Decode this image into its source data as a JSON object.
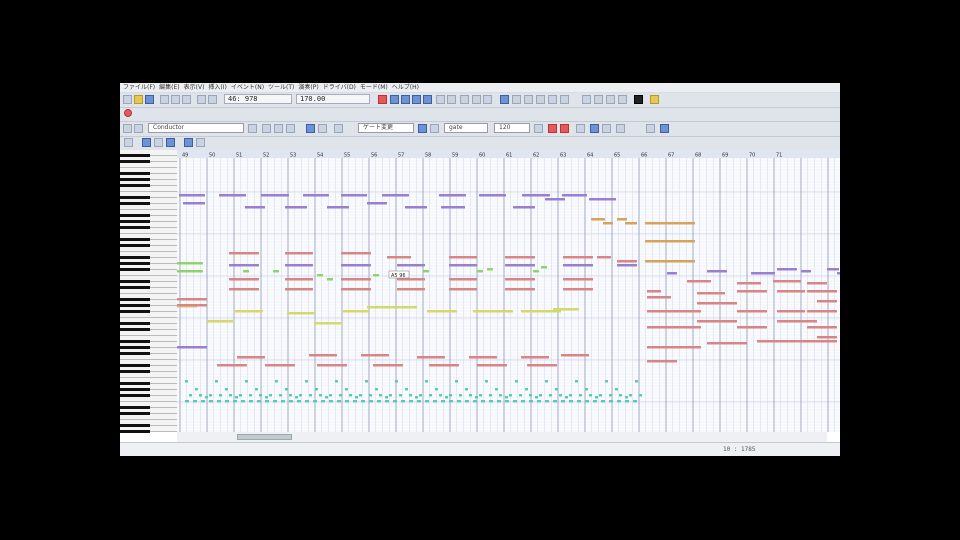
{
  "window": {
    "menu": [
      "ファイル(F)",
      "編集(E)",
      "表示(V)",
      "挿入(I)",
      "イベント(N)",
      "ツール(T)",
      "演奏(P)",
      "ドライバ(D)",
      "モード(M)",
      "ヘルプ(H)"
    ]
  },
  "toolbar": {
    "position_readout": "46: 978",
    "tempo_readout": "170.00",
    "track_combo": "Conductor",
    "mode_combo": "ゲート変更",
    "pencil_combo": "gate",
    "length_combo": "120"
  },
  "ruler": {
    "measures": [
      "49",
      "50",
      "51",
      "52",
      "53",
      "54",
      "55",
      "56",
      "57",
      "58",
      "59",
      "60",
      "61",
      "62",
      "63",
      "64",
      "65",
      "66",
      "67",
      "68",
      "69",
      "70",
      "71"
    ]
  },
  "piano_roll": {
    "tooltip": "A5 96",
    "colors": {
      "purple": "#9a7fd1",
      "pink": "#d98585",
      "orange": "#d8a25a",
      "yellow": "#d6d86a",
      "green": "#8fd46a",
      "cyan": "#58c9b8",
      "grid_major": "#8e96b8",
      "grid_minor": "#d0d8ea",
      "grid_row": "#e6ecf5"
    }
  },
  "status": {
    "position": "10 : 1785"
  }
}
